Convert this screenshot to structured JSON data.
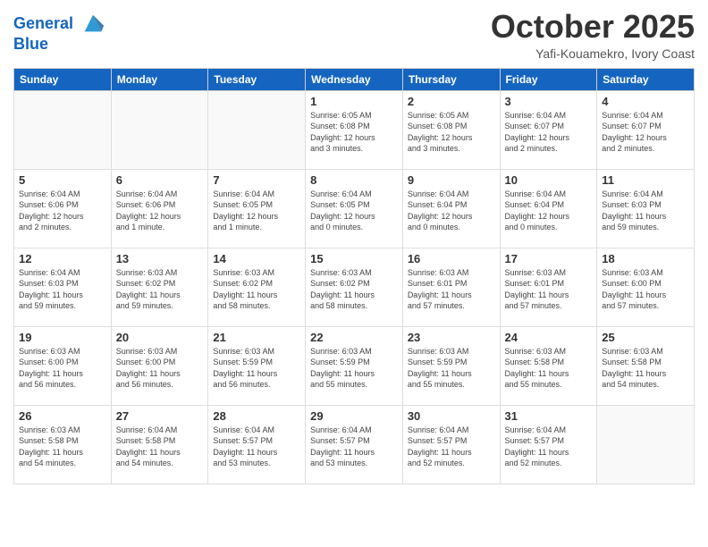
{
  "header": {
    "logo_line1": "General",
    "logo_line2": "Blue",
    "month": "October 2025",
    "location": "Yafi-Kouamekro, Ivory Coast"
  },
  "weekdays": [
    "Sunday",
    "Monday",
    "Tuesday",
    "Wednesday",
    "Thursday",
    "Friday",
    "Saturday"
  ],
  "weeks": [
    [
      {
        "day": "",
        "info": ""
      },
      {
        "day": "",
        "info": ""
      },
      {
        "day": "",
        "info": ""
      },
      {
        "day": "1",
        "info": "Sunrise: 6:05 AM\nSunset: 6:08 PM\nDaylight: 12 hours\nand 3 minutes."
      },
      {
        "day": "2",
        "info": "Sunrise: 6:05 AM\nSunset: 6:08 PM\nDaylight: 12 hours\nand 3 minutes."
      },
      {
        "day": "3",
        "info": "Sunrise: 6:04 AM\nSunset: 6:07 PM\nDaylight: 12 hours\nand 2 minutes."
      },
      {
        "day": "4",
        "info": "Sunrise: 6:04 AM\nSunset: 6:07 PM\nDaylight: 12 hours\nand 2 minutes."
      }
    ],
    [
      {
        "day": "5",
        "info": "Sunrise: 6:04 AM\nSunset: 6:06 PM\nDaylight: 12 hours\nand 2 minutes."
      },
      {
        "day": "6",
        "info": "Sunrise: 6:04 AM\nSunset: 6:06 PM\nDaylight: 12 hours\nand 1 minute."
      },
      {
        "day": "7",
        "info": "Sunrise: 6:04 AM\nSunset: 6:05 PM\nDaylight: 12 hours\nand 1 minute."
      },
      {
        "day": "8",
        "info": "Sunrise: 6:04 AM\nSunset: 6:05 PM\nDaylight: 12 hours\nand 0 minutes."
      },
      {
        "day": "9",
        "info": "Sunrise: 6:04 AM\nSunset: 6:04 PM\nDaylight: 12 hours\nand 0 minutes."
      },
      {
        "day": "10",
        "info": "Sunrise: 6:04 AM\nSunset: 6:04 PM\nDaylight: 12 hours\nand 0 minutes."
      },
      {
        "day": "11",
        "info": "Sunrise: 6:04 AM\nSunset: 6:03 PM\nDaylight: 11 hours\nand 59 minutes."
      }
    ],
    [
      {
        "day": "12",
        "info": "Sunrise: 6:04 AM\nSunset: 6:03 PM\nDaylight: 11 hours\nand 59 minutes."
      },
      {
        "day": "13",
        "info": "Sunrise: 6:03 AM\nSunset: 6:02 PM\nDaylight: 11 hours\nand 59 minutes."
      },
      {
        "day": "14",
        "info": "Sunrise: 6:03 AM\nSunset: 6:02 PM\nDaylight: 11 hours\nand 58 minutes."
      },
      {
        "day": "15",
        "info": "Sunrise: 6:03 AM\nSunset: 6:02 PM\nDaylight: 11 hours\nand 58 minutes."
      },
      {
        "day": "16",
        "info": "Sunrise: 6:03 AM\nSunset: 6:01 PM\nDaylight: 11 hours\nand 57 minutes."
      },
      {
        "day": "17",
        "info": "Sunrise: 6:03 AM\nSunset: 6:01 PM\nDaylight: 11 hours\nand 57 minutes."
      },
      {
        "day": "18",
        "info": "Sunrise: 6:03 AM\nSunset: 6:00 PM\nDaylight: 11 hours\nand 57 minutes."
      }
    ],
    [
      {
        "day": "19",
        "info": "Sunrise: 6:03 AM\nSunset: 6:00 PM\nDaylight: 11 hours\nand 56 minutes."
      },
      {
        "day": "20",
        "info": "Sunrise: 6:03 AM\nSunset: 6:00 PM\nDaylight: 11 hours\nand 56 minutes."
      },
      {
        "day": "21",
        "info": "Sunrise: 6:03 AM\nSunset: 5:59 PM\nDaylight: 11 hours\nand 56 minutes."
      },
      {
        "day": "22",
        "info": "Sunrise: 6:03 AM\nSunset: 5:59 PM\nDaylight: 11 hours\nand 55 minutes."
      },
      {
        "day": "23",
        "info": "Sunrise: 6:03 AM\nSunset: 5:59 PM\nDaylight: 11 hours\nand 55 minutes."
      },
      {
        "day": "24",
        "info": "Sunrise: 6:03 AM\nSunset: 5:58 PM\nDaylight: 11 hours\nand 55 minutes."
      },
      {
        "day": "25",
        "info": "Sunrise: 6:03 AM\nSunset: 5:58 PM\nDaylight: 11 hours\nand 54 minutes."
      }
    ],
    [
      {
        "day": "26",
        "info": "Sunrise: 6:03 AM\nSunset: 5:58 PM\nDaylight: 11 hours\nand 54 minutes."
      },
      {
        "day": "27",
        "info": "Sunrise: 6:04 AM\nSunset: 5:58 PM\nDaylight: 11 hours\nand 54 minutes."
      },
      {
        "day": "28",
        "info": "Sunrise: 6:04 AM\nSunset: 5:57 PM\nDaylight: 11 hours\nand 53 minutes."
      },
      {
        "day": "29",
        "info": "Sunrise: 6:04 AM\nSunset: 5:57 PM\nDaylight: 11 hours\nand 53 minutes."
      },
      {
        "day": "30",
        "info": "Sunrise: 6:04 AM\nSunset: 5:57 PM\nDaylight: 11 hours\nand 52 minutes."
      },
      {
        "day": "31",
        "info": "Sunrise: 6:04 AM\nSunset: 5:57 PM\nDaylight: 11 hours\nand 52 minutes."
      },
      {
        "day": "",
        "info": ""
      }
    ]
  ]
}
